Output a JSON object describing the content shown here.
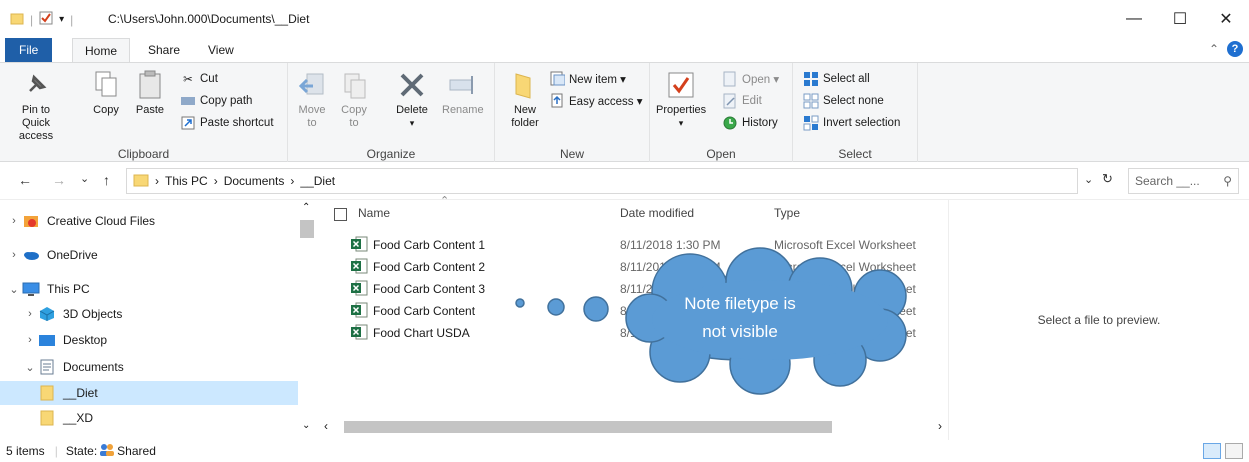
{
  "title": {
    "path": "C:\\Users\\John.000\\Documents\\__Diet"
  },
  "window_controls": {
    "minimize": "—",
    "maximize": "☐",
    "close": "✕"
  },
  "tabs": [
    "File",
    "Home",
    "Share",
    "View"
  ],
  "ribbon": {
    "clipboard": {
      "label": "Clipboard",
      "pin": "Pin to Quick access",
      "copy": "Copy",
      "paste": "Paste",
      "cut": "Cut",
      "copy_path": "Copy path",
      "paste_shortcut": "Paste shortcut"
    },
    "organize": {
      "label": "Organize",
      "move_to": "Move to",
      "copy_to": "Copy to",
      "delete": "Delete",
      "rename": "Rename"
    },
    "new": {
      "label": "New",
      "new_folder": "New folder",
      "new_item": "New item ▾",
      "easy_access": "Easy access ▾"
    },
    "open": {
      "label": "Open",
      "properties": "Properties",
      "open": "Open ▾",
      "edit": "Edit",
      "history": "History"
    },
    "select": {
      "label": "Select",
      "select_all": "Select all",
      "select_none": "Select none",
      "invert": "Invert selection"
    }
  },
  "address": {
    "breadcrumb": [
      "This PC",
      "Documents",
      "__Diet"
    ],
    "search_placeholder": "Search __..."
  },
  "nav": [
    {
      "label": "Creative Cloud Files",
      "icon": "creative-cloud-icon",
      "expander": "›"
    },
    {
      "label": "OneDrive",
      "icon": "onedrive-icon",
      "expander": "›"
    },
    {
      "label": "This PC",
      "icon": "pc-icon",
      "expander": "⌄"
    },
    {
      "label": "3D Objects",
      "icon": "3d-objects-icon",
      "expander": "›"
    },
    {
      "label": "Desktop",
      "icon": "desktop-icon",
      "expander": "›"
    },
    {
      "label": "Documents",
      "icon": "documents-icon",
      "expander": "⌄"
    },
    {
      "label": "__Diet",
      "icon": "folder-icon",
      "expander": ""
    },
    {
      "label": "__XD",
      "icon": "folder-icon",
      "expander": ""
    }
  ],
  "columns": {
    "name": "Name",
    "date": "Date modified",
    "type": "Type"
  },
  "files": [
    {
      "name": "Food Carb Content 1",
      "date": "8/11/2018 1:30 PM",
      "type": "Microsoft Excel Worksheet"
    },
    {
      "name": "Food Carb Content 2",
      "date": "8/11/2018 2:55 PM",
      "type": "Microsoft Excel Worksheet"
    },
    {
      "name": "Food Carb Content 3",
      "date": "8/11/2018",
      "type": "Microsoft Excel Worksheet"
    },
    {
      "name": "Food Carb Content",
      "date": "8/11/2018",
      "type": "Microsoft Excel Worksheet"
    },
    {
      "name": "Food Chart USDA",
      "date": "8/11/2018",
      "type": "Microsoft Excel Worksheet"
    }
  ],
  "preview": {
    "message": "Select a file to preview."
  },
  "status": {
    "items": "5 items",
    "state_label": "State:",
    "state_value": "Shared"
  },
  "callout": {
    "line1": "Note filetype is",
    "line2": "not visible",
    "fill": "#5b9bd5",
    "stroke": "#41719c"
  }
}
